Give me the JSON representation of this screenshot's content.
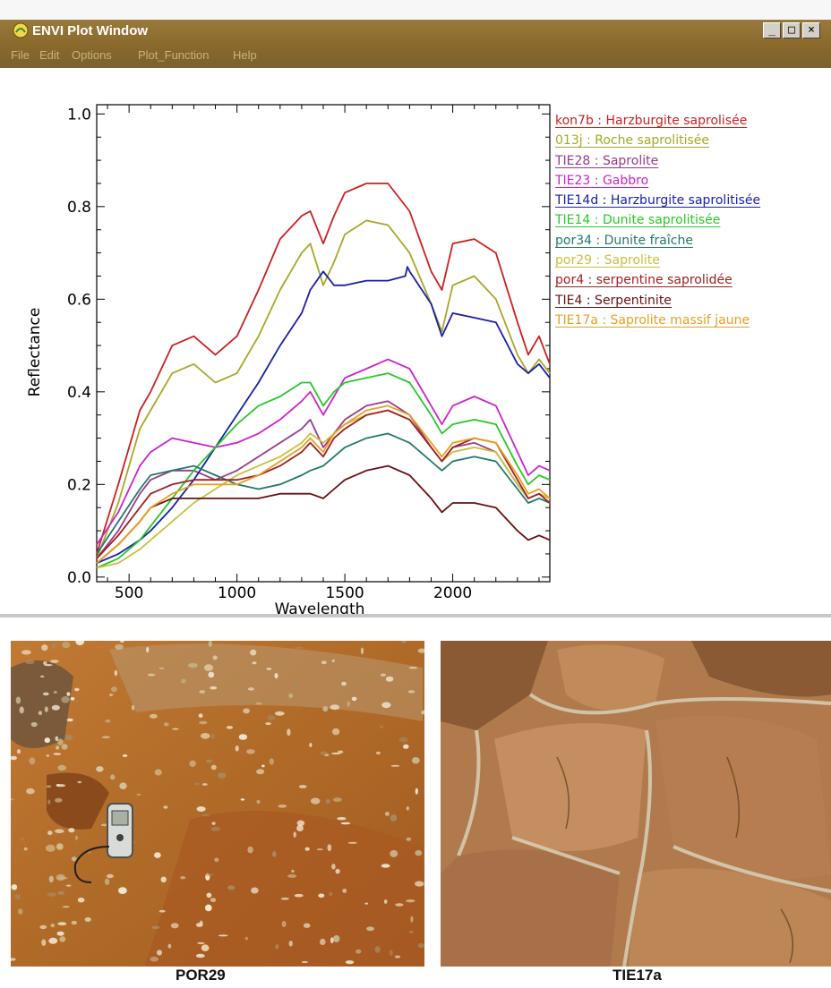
{
  "window": {
    "title": "ENVI Plot Window",
    "menu": [
      "File",
      "Edit",
      "Options",
      "Plot_Function",
      "Help"
    ],
    "controls": [
      "_",
      "□",
      "×"
    ],
    "colors": {
      "title_bar": "#8a6a2c",
      "menu_text": "#c9b27a"
    }
  },
  "chart_data": {
    "type": "line",
    "xlabel": "Wavelength",
    "ylabel": "Reflectance",
    "xlim": [
      350,
      2450
    ],
    "ylim": [
      -0.01,
      1.02
    ],
    "xticks": [
      500,
      1000,
      1500,
      2000
    ],
    "yticks": [
      0.0,
      0.2,
      0.4,
      0.6,
      0.8,
      1.0
    ],
    "ytick_labels": [
      "0.0",
      "0.2",
      "0.4",
      "0.6",
      "0.8",
      "1.0"
    ],
    "grid": false,
    "legend_position": "right",
    "series": [
      {
        "name": "kon7b : Harzburgite saprolisée",
        "color": "#cc2020",
        "x": [
          350,
          450,
          550,
          600,
          700,
          800,
          900,
          1000,
          1100,
          1200,
          1300,
          1340,
          1400,
          1450,
          1500,
          1600,
          1700,
          1800,
          1900,
          1950,
          2000,
          2100,
          2200,
          2300,
          2350,
          2400,
          2450
        ],
        "y": [
          0.05,
          0.2,
          0.36,
          0.4,
          0.5,
          0.52,
          0.48,
          0.52,
          0.62,
          0.73,
          0.78,
          0.79,
          0.72,
          0.78,
          0.83,
          0.85,
          0.85,
          0.79,
          0.66,
          0.62,
          0.72,
          0.73,
          0.7,
          0.55,
          0.48,
          0.52,
          0.46
        ]
      },
      {
        "name": "013j : Roche saprolitisée",
        "color": "#a8a828",
        "x": [
          350,
          450,
          550,
          600,
          700,
          800,
          900,
          1000,
          1100,
          1200,
          1300,
          1340,
          1400,
          1450,
          1500,
          1600,
          1700,
          1800,
          1900,
          1950,
          2000,
          2100,
          2200,
          2300,
          2350,
          2400,
          2450
        ],
        "y": [
          0.04,
          0.16,
          0.32,
          0.36,
          0.44,
          0.46,
          0.42,
          0.44,
          0.52,
          0.62,
          0.7,
          0.72,
          0.63,
          0.68,
          0.74,
          0.77,
          0.76,
          0.7,
          0.59,
          0.53,
          0.63,
          0.65,
          0.6,
          0.48,
          0.44,
          0.47,
          0.44
        ]
      },
      {
        "name": "TIE28 : Saprolite",
        "color": "#9a3a8a",
        "x": [
          350,
          450,
          550,
          600,
          700,
          800,
          900,
          1000,
          1100,
          1200,
          1300,
          1340,
          1400,
          1450,
          1500,
          1600,
          1700,
          1800,
          1900,
          1950,
          2000,
          2100,
          2200,
          2300,
          2350,
          2400,
          2450
        ],
        "y": [
          0.04,
          0.1,
          0.18,
          0.21,
          0.23,
          0.23,
          0.21,
          0.23,
          0.26,
          0.29,
          0.32,
          0.34,
          0.28,
          0.31,
          0.34,
          0.37,
          0.38,
          0.35,
          0.28,
          0.25,
          0.28,
          0.29,
          0.27,
          0.2,
          0.17,
          0.18,
          0.17
        ]
      },
      {
        "name": "TIE23 : Gabbro",
        "color": "#cc22cc",
        "x": [
          350,
          450,
          550,
          600,
          700,
          800,
          900,
          1000,
          1100,
          1200,
          1300,
          1340,
          1400,
          1450,
          1500,
          1600,
          1700,
          1800,
          1900,
          1950,
          2000,
          2100,
          2200,
          2300,
          2350,
          2400,
          2450
        ],
        "y": [
          0.07,
          0.14,
          0.24,
          0.27,
          0.3,
          0.29,
          0.28,
          0.29,
          0.31,
          0.34,
          0.38,
          0.4,
          0.35,
          0.39,
          0.43,
          0.45,
          0.47,
          0.45,
          0.37,
          0.33,
          0.37,
          0.39,
          0.37,
          0.27,
          0.22,
          0.24,
          0.23
        ]
      },
      {
        "name": "TIE14d : Harzburgite saprolitisée",
        "color": "#1a20a8",
        "x": [
          350,
          450,
          550,
          600,
          700,
          800,
          900,
          1000,
          1100,
          1200,
          1300,
          1340,
          1400,
          1450,
          1500,
          1600,
          1700,
          1780,
          1790,
          1800,
          1900,
          1950,
          2000,
          2100,
          2200,
          2300,
          2350,
          2400,
          2450
        ],
        "y": [
          0.03,
          0.05,
          0.08,
          0.1,
          0.15,
          0.21,
          0.28,
          0.35,
          0.42,
          0.5,
          0.57,
          0.62,
          0.66,
          0.63,
          0.63,
          0.64,
          0.64,
          0.65,
          0.67,
          0.66,
          0.59,
          0.52,
          0.57,
          0.56,
          0.55,
          0.46,
          0.44,
          0.46,
          0.43
        ]
      },
      {
        "name": "TIE14 : Dunite saprolitisée",
        "color": "#28c828",
        "x": [
          350,
          450,
          550,
          600,
          700,
          800,
          900,
          1000,
          1100,
          1200,
          1300,
          1340,
          1400,
          1450,
          1500,
          1600,
          1700,
          1800,
          1900,
          1950,
          2000,
          2100,
          2200,
          2300,
          2350,
          2400,
          2450
        ],
        "y": [
          0.02,
          0.04,
          0.08,
          0.11,
          0.17,
          0.23,
          0.28,
          0.33,
          0.37,
          0.39,
          0.42,
          0.42,
          0.37,
          0.4,
          0.42,
          0.43,
          0.44,
          0.42,
          0.35,
          0.31,
          0.33,
          0.34,
          0.33,
          0.24,
          0.2,
          0.22,
          0.21
        ]
      },
      {
        "name": "por34 : Dunite fraîche",
        "color": "#207a6a",
        "x": [
          350,
          450,
          550,
          600,
          700,
          800,
          900,
          1000,
          1100,
          1200,
          1300,
          1340,
          1400,
          1450,
          1500,
          1600,
          1700,
          1800,
          1900,
          1950,
          2000,
          2100,
          2200,
          2300,
          2350,
          2400,
          2450
        ],
        "y": [
          0.05,
          0.12,
          0.19,
          0.22,
          0.23,
          0.24,
          0.22,
          0.2,
          0.19,
          0.2,
          0.22,
          0.23,
          0.24,
          0.26,
          0.28,
          0.3,
          0.31,
          0.29,
          0.25,
          0.23,
          0.25,
          0.26,
          0.25,
          0.19,
          0.16,
          0.17,
          0.16
        ]
      },
      {
        "name": "por29 : Saprolite",
        "color": "#c8c040",
        "x": [
          350,
          450,
          550,
          600,
          700,
          800,
          900,
          1000,
          1100,
          1200,
          1300,
          1340,
          1400,
          1450,
          1500,
          1600,
          1700,
          1800,
          1900,
          1950,
          2000,
          2100,
          2200,
          2300,
          2350,
          2400,
          2450
        ],
        "y": [
          0.02,
          0.03,
          0.06,
          0.08,
          0.12,
          0.16,
          0.19,
          0.22,
          0.24,
          0.26,
          0.29,
          0.31,
          0.29,
          0.31,
          0.33,
          0.35,
          0.36,
          0.34,
          0.28,
          0.25,
          0.27,
          0.28,
          0.27,
          0.2,
          0.17,
          0.18,
          0.17
        ]
      },
      {
        "name": "por4 : serpentine saprolidée",
        "color": "#a02020",
        "x": [
          350,
          450,
          550,
          600,
          700,
          800,
          900,
          1000,
          1100,
          1200,
          1300,
          1340,
          1400,
          1450,
          1500,
          1600,
          1700,
          1800,
          1900,
          1950,
          2000,
          2100,
          2200,
          2300,
          2350,
          2400,
          2450
        ],
        "y": [
          0.04,
          0.09,
          0.15,
          0.18,
          0.2,
          0.21,
          0.21,
          0.21,
          0.22,
          0.24,
          0.27,
          0.29,
          0.26,
          0.3,
          0.32,
          0.35,
          0.36,
          0.34,
          0.28,
          0.25,
          0.28,
          0.3,
          0.29,
          0.21,
          0.17,
          0.18,
          0.16
        ]
      },
      {
        "name": "TIE4 : Serpentinite",
        "color": "#6a1010",
        "x": [
          350,
          450,
          550,
          600,
          700,
          800,
          900,
          1000,
          1100,
          1200,
          1300,
          1340,
          1400,
          1450,
          1500,
          1600,
          1700,
          1800,
          1900,
          1950,
          2000,
          2100,
          2200,
          2300,
          2350,
          2400,
          2450
        ],
        "y": [
          0.03,
          0.07,
          0.12,
          0.15,
          0.17,
          0.17,
          0.17,
          0.17,
          0.17,
          0.18,
          0.18,
          0.18,
          0.17,
          0.19,
          0.21,
          0.23,
          0.24,
          0.22,
          0.17,
          0.14,
          0.16,
          0.16,
          0.15,
          0.1,
          0.08,
          0.09,
          0.08
        ]
      },
      {
        "name": "TIE17a : Saprolite massif jaune",
        "color": "#e8a020",
        "x": [
          350,
          450,
          550,
          600,
          700,
          800,
          900,
          1000,
          1100,
          1200,
          1300,
          1340,
          1400,
          1450,
          1500,
          1600,
          1700,
          1800,
          1900,
          1950,
          2000,
          2100,
          2200,
          2300,
          2350,
          2400,
          2450
        ],
        "y": [
          0.03,
          0.07,
          0.12,
          0.15,
          0.18,
          0.2,
          0.2,
          0.2,
          0.22,
          0.25,
          0.28,
          0.3,
          0.27,
          0.31,
          0.33,
          0.36,
          0.37,
          0.35,
          0.29,
          0.26,
          0.29,
          0.3,
          0.29,
          0.22,
          0.18,
          0.19,
          0.17
        ]
      }
    ]
  },
  "photos": [
    {
      "label": "POR29",
      "subject": "orange-brown lateritic soil with pale gravel and a handheld GPS unit",
      "colors": {
        "base": "#b8702e",
        "light": "#e0a860",
        "dark": "#6a3a14"
      }
    },
    {
      "label": "TIE17a",
      "subject": "massive weathered orange saprolite rock with pale cracks",
      "colors": {
        "base": "#b87a4a",
        "light": "#d8a878",
        "dark": "#7a4a28"
      }
    }
  ]
}
